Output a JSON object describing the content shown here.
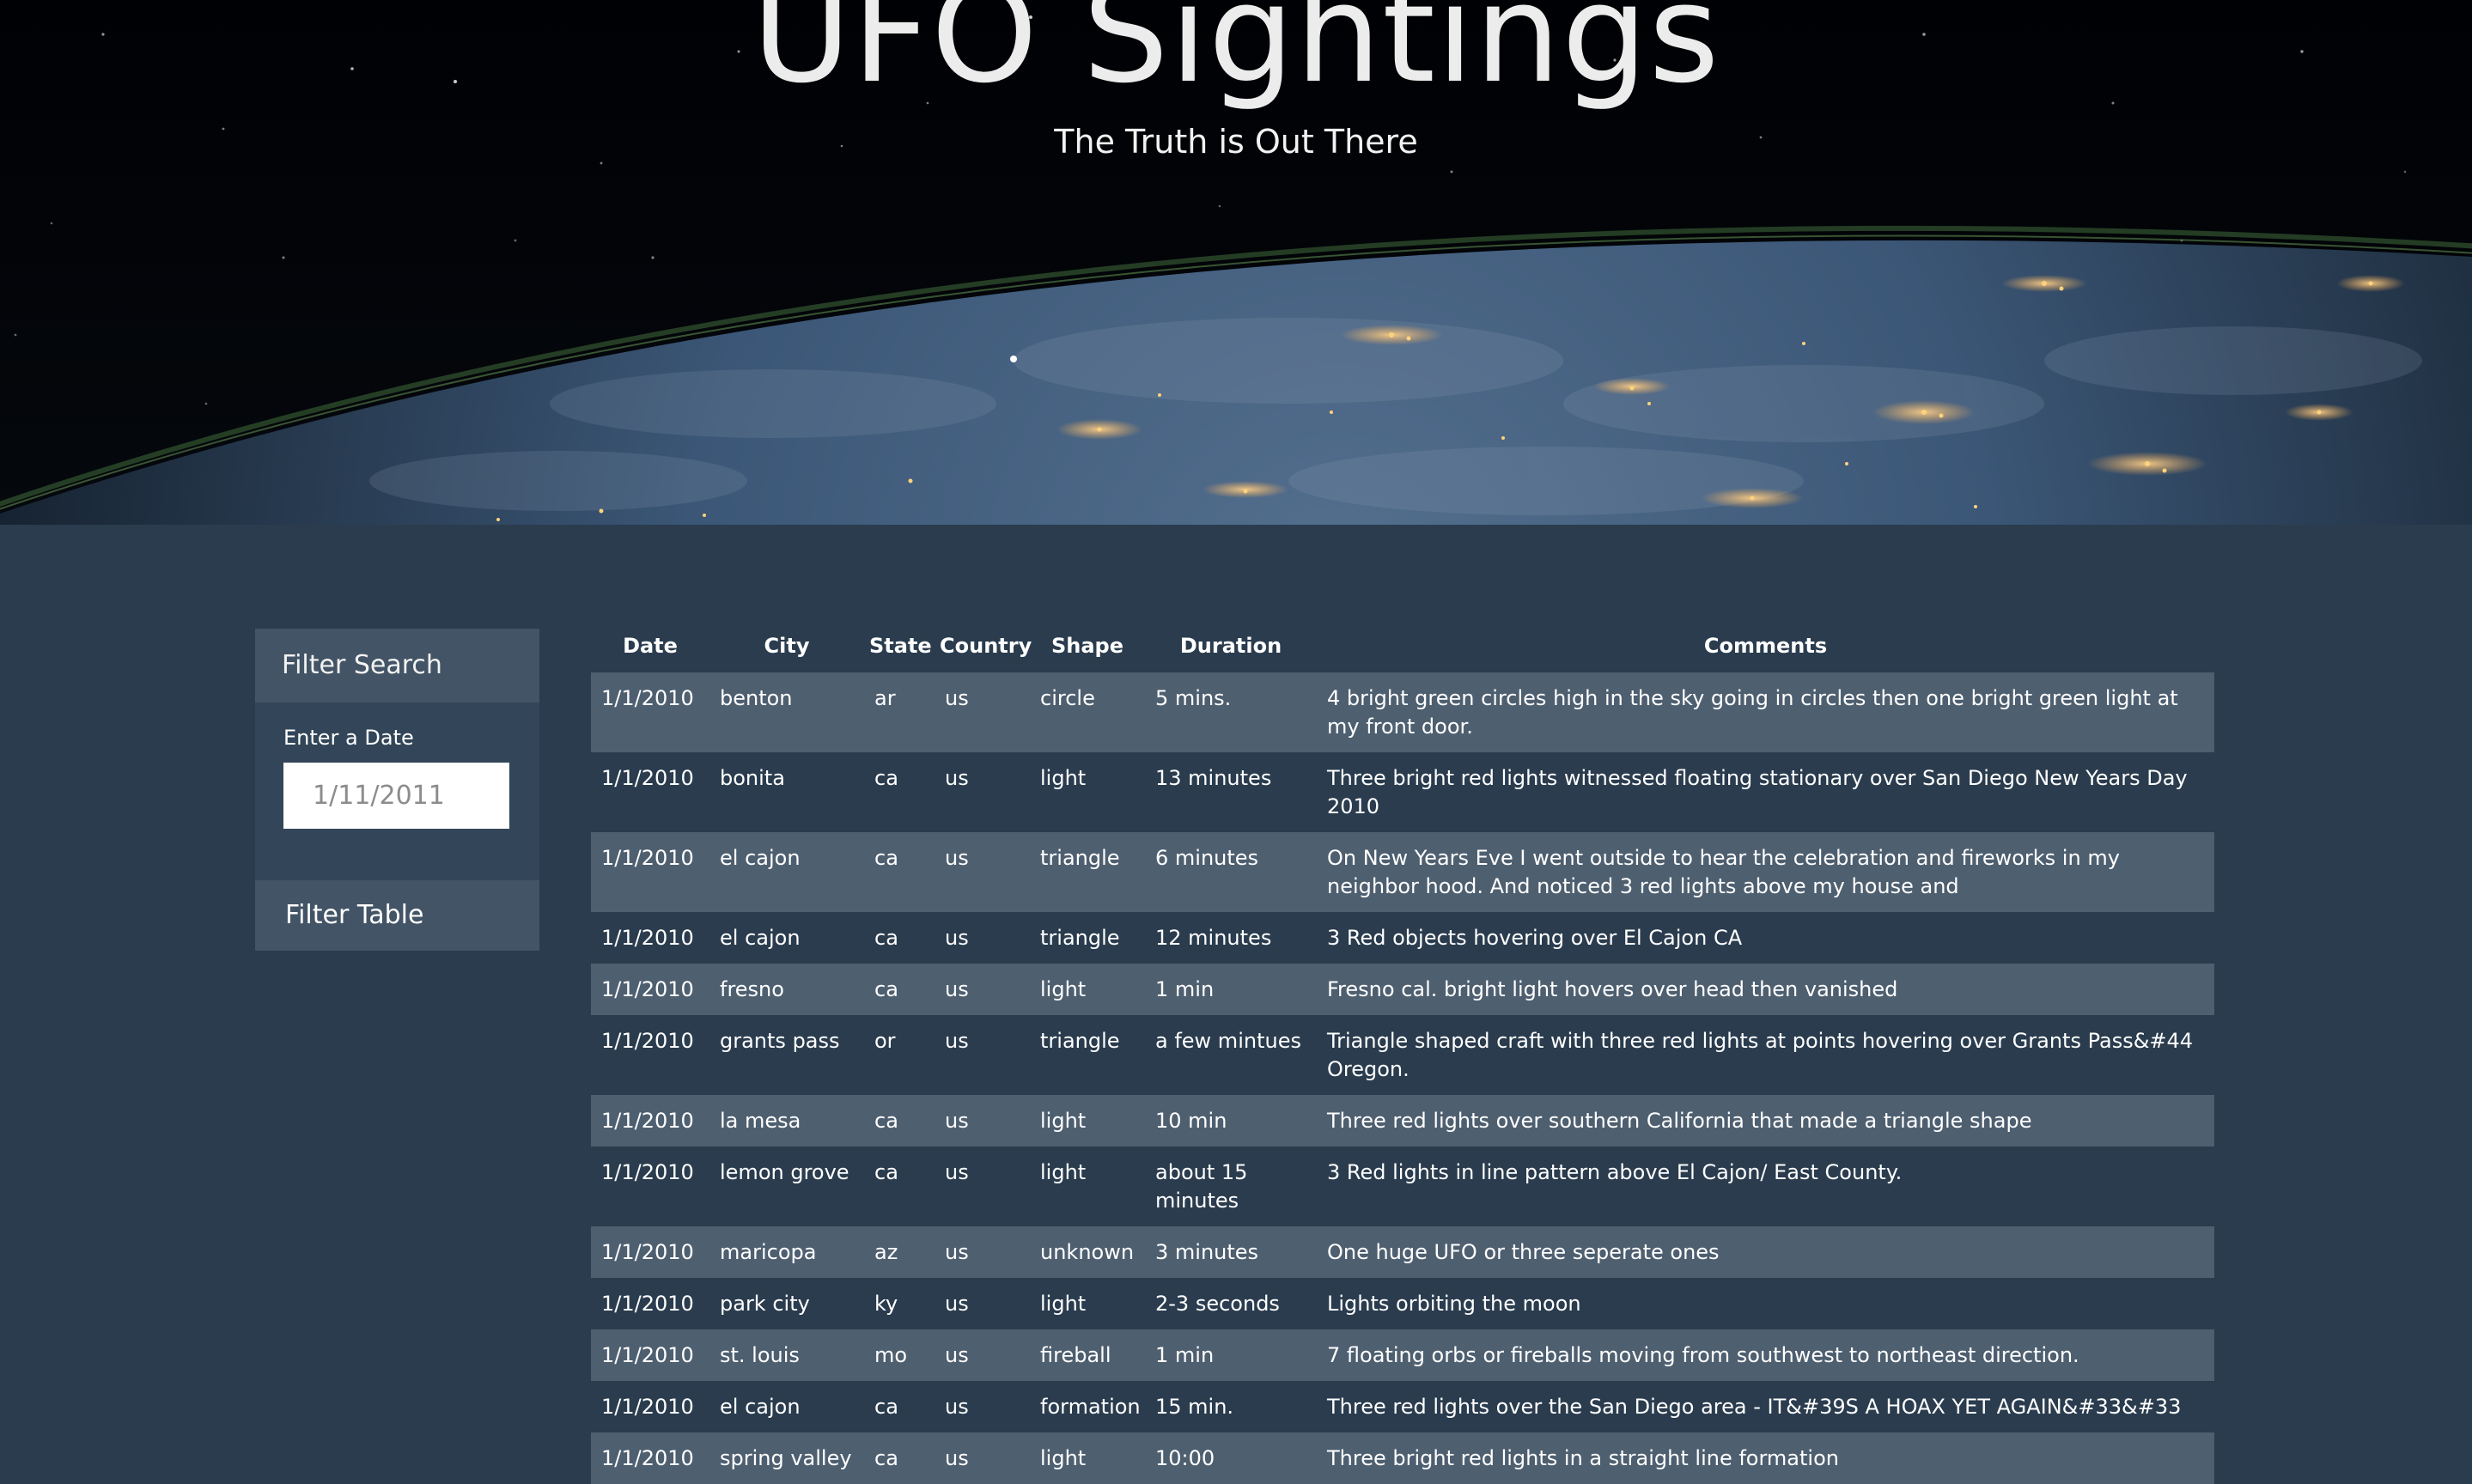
{
  "hero": {
    "title": "UFO Sightings",
    "subtitle": "The Truth is Out There"
  },
  "filter": {
    "heading": "Filter Search",
    "date_label": "Enter a Date",
    "date_placeholder": "1/11/2011",
    "date_value": "",
    "button_label": "Filter Table"
  },
  "table": {
    "columns": [
      "Date",
      "City",
      "State",
      "Country",
      "Shape",
      "Duration",
      "Comments"
    ],
    "rows": [
      [
        "1/1/2010",
        "benton",
        "ar",
        "us",
        "circle",
        "5 mins.",
        "4 bright green circles high in the sky going in circles then one bright green light at my front door."
      ],
      [
        "1/1/2010",
        "bonita",
        "ca",
        "us",
        "light",
        "13 minutes",
        "Three bright red lights witnessed floating stationary over San Diego New Years Day 2010"
      ],
      [
        "1/1/2010",
        "el cajon",
        "ca",
        "us",
        "triangle",
        "6 minutes",
        "On New Years Eve I went outside to hear the celebration and fireworks in my neighbor hood. And noticed 3 red lights above my house and"
      ],
      [
        "1/1/2010",
        "el cajon",
        "ca",
        "us",
        "triangle",
        "12 minutes",
        "3 Red objects hovering over El Cajon CA"
      ],
      [
        "1/1/2010",
        "fresno",
        "ca",
        "us",
        "light",
        "1 min",
        "Fresno cal. bright light hovers over head then vanished"
      ],
      [
        "1/1/2010",
        "grants pass",
        "or",
        "us",
        "triangle",
        "a few mintues",
        "Triangle shaped craft with three red lights at points hovering over Grants Pass&#44 Oregon."
      ],
      [
        "1/1/2010",
        "la mesa",
        "ca",
        "us",
        "light",
        "10 min",
        "Three red lights over southern California that made a triangle shape"
      ],
      [
        "1/1/2010",
        "lemon grove",
        "ca",
        "us",
        "light",
        "about 15 minutes",
        "3 Red lights in line pattern above El Cajon/ East County."
      ],
      [
        "1/1/2010",
        "maricopa",
        "az",
        "us",
        "unknown",
        "3 minutes",
        "One huge UFO or three seperate ones"
      ],
      [
        "1/1/2010",
        "park city",
        "ky",
        "us",
        "light",
        "2-3 seconds",
        "Lights orbiting the moon"
      ],
      [
        "1/1/2010",
        "st. louis",
        "mo",
        "us",
        "fireball",
        "1 min",
        "7 floating orbs or fireballs moving from southwest to northeast direction."
      ],
      [
        "1/1/2010",
        "el cajon",
        "ca",
        "us",
        "formation",
        "15 min.",
        "Three red lights over the San Diego area - IT&#39S A HOAX YET AGAIN&#33&#33"
      ],
      [
        "1/1/2010",
        "spring valley",
        "ca",
        "us",
        "light",
        "10:00",
        "Three bright red lights in a straight line formation"
      ]
    ]
  }
}
